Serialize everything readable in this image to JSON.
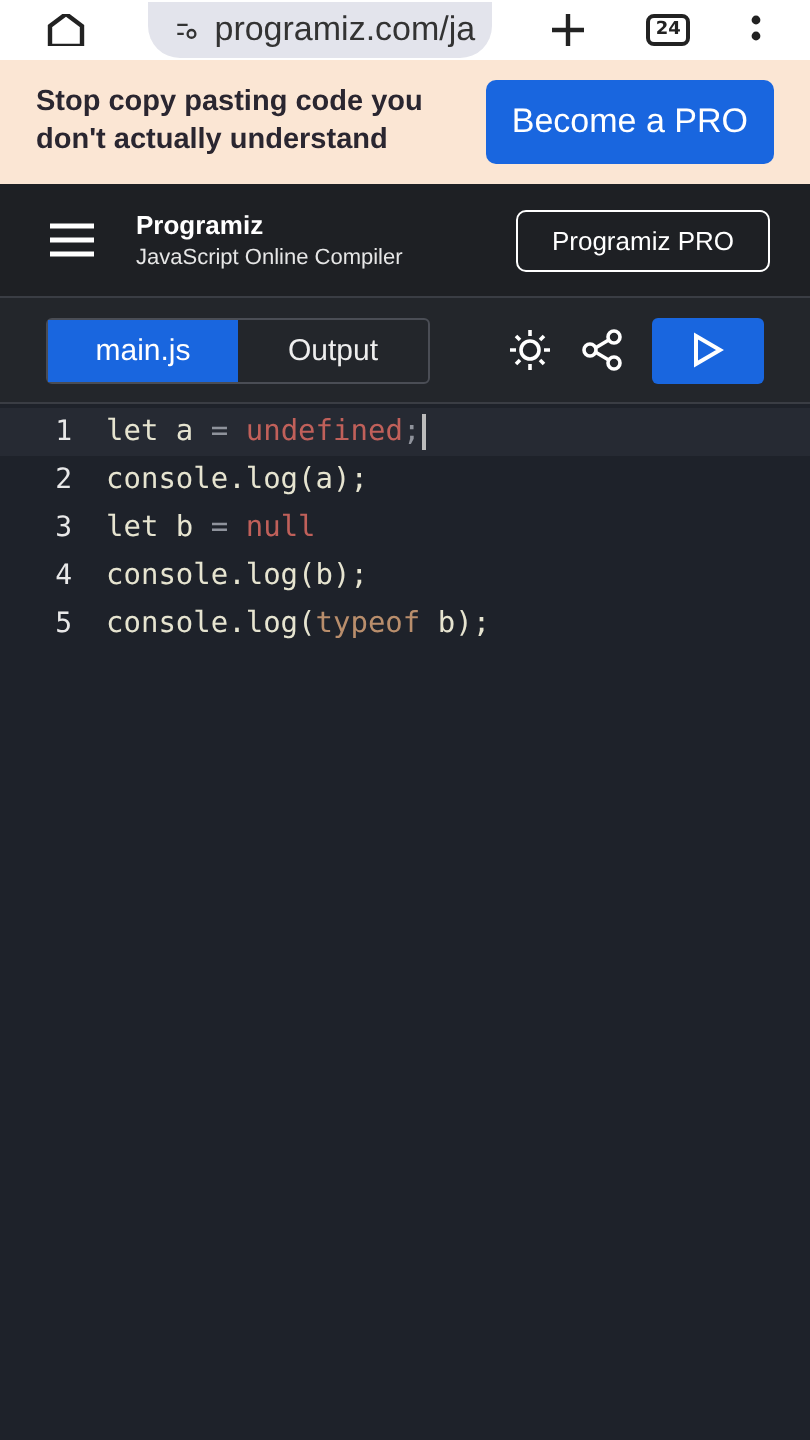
{
  "browser": {
    "url": "programiz.com/ja",
    "tab_count": "24"
  },
  "banner": {
    "text": "Stop copy pasting code you don't actually understand",
    "button": "Become a PRO"
  },
  "header": {
    "logo": "Programiz",
    "subtitle": "JavaScript Online Compiler",
    "button": "Programiz PRO"
  },
  "tabs": [
    {
      "label": "main.js",
      "selected": true
    },
    {
      "label": "Output",
      "selected": false
    }
  ],
  "editor": {
    "lines": [
      {
        "number": "1",
        "active": true,
        "tokens": [
          {
            "kind": "text",
            "text": "let a "
          },
          {
            "kind": "op",
            "text": "="
          },
          {
            "kind": "literal",
            "text": " undefined"
          },
          {
            "kind": "op",
            "text": ";"
          }
        ]
      },
      {
        "number": "2",
        "active": false,
        "tokens": [
          {
            "kind": "text",
            "text": "console.log(a);"
          }
        ]
      },
      {
        "number": "3",
        "active": false,
        "tokens": [
          {
            "kind": "text",
            "text": "let b "
          },
          {
            "kind": "op",
            "text": "="
          },
          {
            "kind": "literal",
            "text": " null"
          }
        ]
      },
      {
        "number": "4",
        "active": false,
        "tokens": [
          {
            "kind": "text",
            "text": "console.log(b);"
          }
        ]
      },
      {
        "number": "5",
        "active": false,
        "tokens": [
          {
            "kind": "text",
            "text": "console.log("
          },
          {
            "kind": "keyword",
            "text": "typeof"
          },
          {
            "kind": "text",
            "text": " b);"
          }
        ]
      }
    ]
  }
}
